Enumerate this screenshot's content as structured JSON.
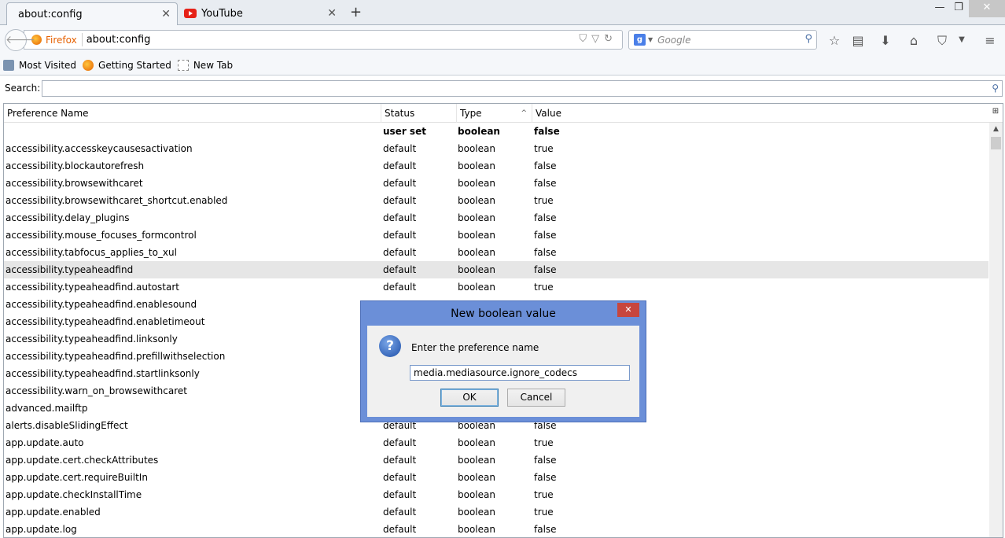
{
  "tabs": [
    {
      "label": "about:config",
      "close": "✕"
    },
    {
      "label": "YouTube",
      "close": "✕"
    }
  ],
  "new_tab": "+",
  "window": {
    "min": "—",
    "max": "❐",
    "close": "✕"
  },
  "navbar": {
    "identity_label": "Firefox",
    "url": "about:config",
    "search_placeholder": "Google",
    "search_engine_letter": "g"
  },
  "bookmarks": [
    {
      "label": "Most Visited",
      "icon": "most-visited-icon"
    },
    {
      "label": "Getting Started",
      "icon": "firefox-icon"
    },
    {
      "label": "New Tab",
      "icon": "new-tab-icon"
    }
  ],
  "config_search": {
    "label": "Search:",
    "value": ""
  },
  "columns": {
    "name": "Preference Name",
    "status": "Status",
    "type": "Type",
    "value": "Value"
  },
  "rows": [
    {
      "name": "",
      "status": "user set",
      "type": "boolean",
      "value": "false",
      "bold": true
    },
    {
      "name": "accessibility.accesskeycausesactivation",
      "status": "default",
      "type": "boolean",
      "value": "true"
    },
    {
      "name": "accessibility.blockautorefresh",
      "status": "default",
      "type": "boolean",
      "value": "false"
    },
    {
      "name": "accessibility.browsewithcaret",
      "status": "default",
      "type": "boolean",
      "value": "false"
    },
    {
      "name": "accessibility.browsewithcaret_shortcut.enabled",
      "status": "default",
      "type": "boolean",
      "value": "true"
    },
    {
      "name": "accessibility.delay_plugins",
      "status": "default",
      "type": "boolean",
      "value": "false"
    },
    {
      "name": "accessibility.mouse_focuses_formcontrol",
      "status": "default",
      "type": "boolean",
      "value": "false"
    },
    {
      "name": "accessibility.tabfocus_applies_to_xul",
      "status": "default",
      "type": "boolean",
      "value": "false"
    },
    {
      "name": "accessibility.typeaheadfind",
      "status": "default",
      "type": "boolean",
      "value": "false",
      "selected": true
    },
    {
      "name": "accessibility.typeaheadfind.autostart",
      "status": "default",
      "type": "boolean",
      "value": "true"
    },
    {
      "name": "accessibility.typeaheadfind.enablesound",
      "status": "",
      "type": "",
      "value": ""
    },
    {
      "name": "accessibility.typeaheadfind.enabletimeout",
      "status": "",
      "type": "",
      "value": ""
    },
    {
      "name": "accessibility.typeaheadfind.linksonly",
      "status": "",
      "type": "",
      "value": ""
    },
    {
      "name": "accessibility.typeaheadfind.prefillwithselection",
      "status": "",
      "type": "",
      "value": ""
    },
    {
      "name": "accessibility.typeaheadfind.startlinksonly",
      "status": "",
      "type": "",
      "value": ""
    },
    {
      "name": "accessibility.warn_on_browsewithcaret",
      "status": "",
      "type": "",
      "value": ""
    },
    {
      "name": "advanced.mailftp",
      "status": "",
      "type": "",
      "value": ""
    },
    {
      "name": "alerts.disableSlidingEffect",
      "status": "default",
      "type": "boolean",
      "value": "false"
    },
    {
      "name": "app.update.auto",
      "status": "default",
      "type": "boolean",
      "value": "true"
    },
    {
      "name": "app.update.cert.checkAttributes",
      "status": "default",
      "type": "boolean",
      "value": "false"
    },
    {
      "name": "app.update.cert.requireBuiltIn",
      "status": "default",
      "type": "boolean",
      "value": "false"
    },
    {
      "name": "app.update.checkInstallTime",
      "status": "default",
      "type": "boolean",
      "value": "true"
    },
    {
      "name": "app.update.enabled",
      "status": "default",
      "type": "boolean",
      "value": "true"
    },
    {
      "name": "app.update.log",
      "status": "default",
      "type": "boolean",
      "value": "false"
    }
  ],
  "dialog": {
    "title": "New boolean value",
    "close": "✕",
    "prompt": "Enter the preference name",
    "input_value": "media.mediasource.ignore_codecs",
    "ok": "OK",
    "cancel": "Cancel"
  }
}
